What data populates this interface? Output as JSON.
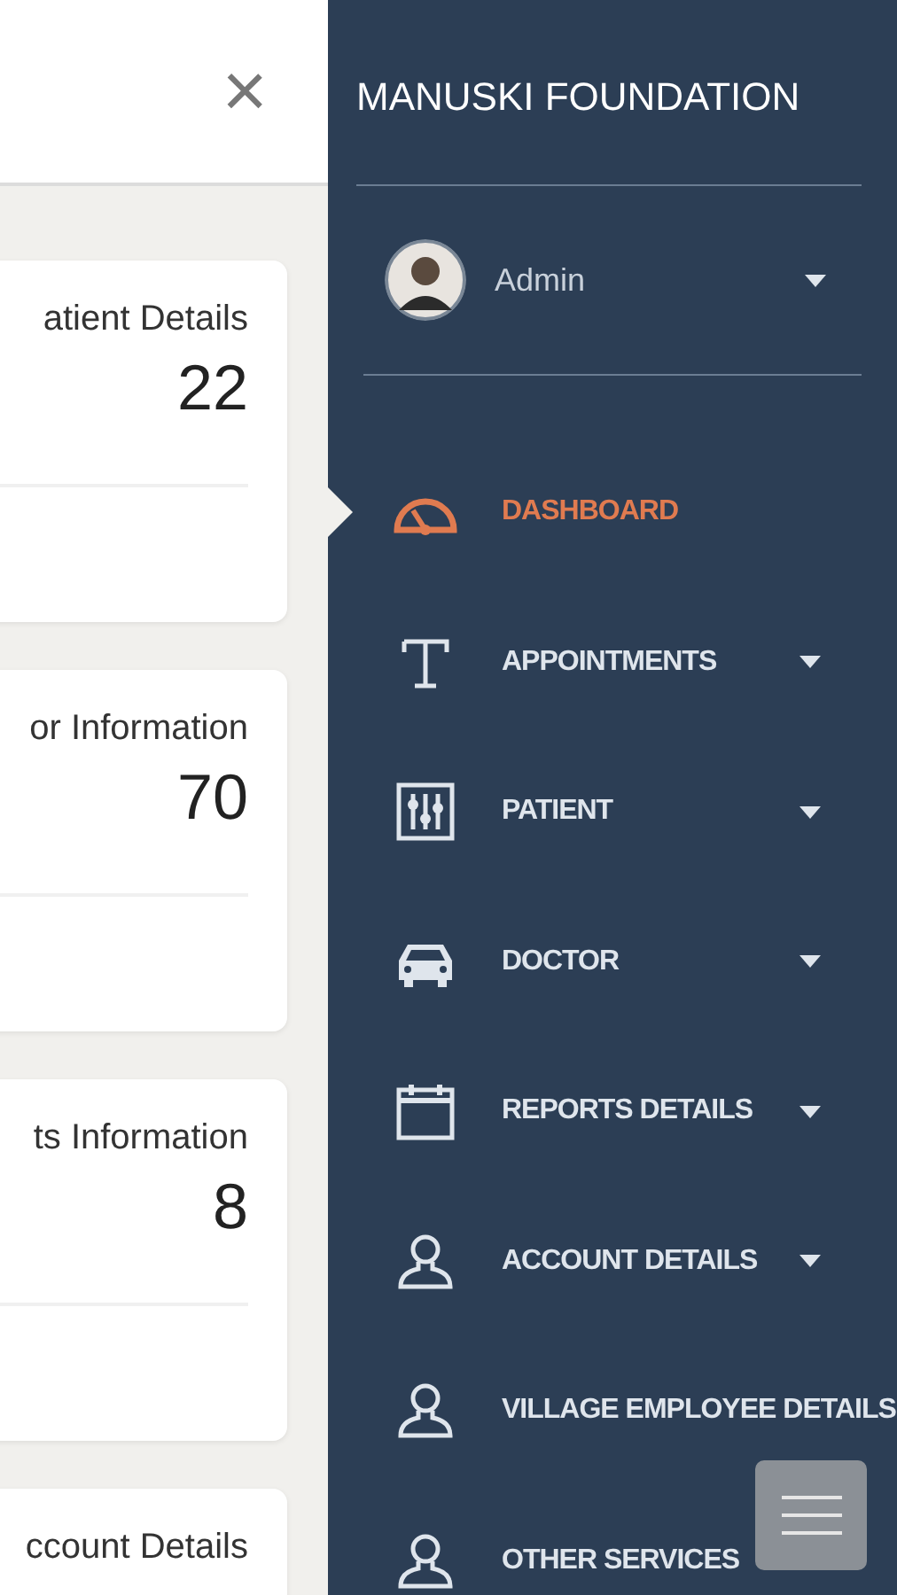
{
  "header": {
    "close": "×"
  },
  "cards": [
    {
      "title": "atient Details",
      "value": "22"
    },
    {
      "title": "or Information",
      "value": "70"
    },
    {
      "title": "ts Information",
      "value": "8"
    },
    {
      "title": "ccount Details"
    }
  ],
  "sidebar": {
    "title": "MANUSKI FOUNDATION",
    "user": {
      "name": "Admin"
    },
    "items": [
      {
        "kind": "gauge",
        "label": "DASHBOARD",
        "selected": true,
        "caret": false
      },
      {
        "kind": "letter",
        "label": "APPOINTMENTS",
        "selected": false,
        "caret": true
      },
      {
        "kind": "sliders",
        "label": "PATIENT",
        "selected": false,
        "caret": true
      },
      {
        "kind": "car",
        "label": "DOCTOR",
        "selected": false,
        "caret": true
      },
      {
        "kind": "calendar",
        "label": "REPORTS DETAILS",
        "selected": false,
        "caret": true
      },
      {
        "kind": "person",
        "label": "ACCOUNT DETAILS",
        "selected": false,
        "caret": true
      },
      {
        "kind": "person",
        "label": "VILLAGE EMPLOYEE DETAILS",
        "selected": false,
        "caret": false
      },
      {
        "kind": "person",
        "label": "OTHER SERVICES",
        "selected": false,
        "caret": false
      }
    ]
  }
}
